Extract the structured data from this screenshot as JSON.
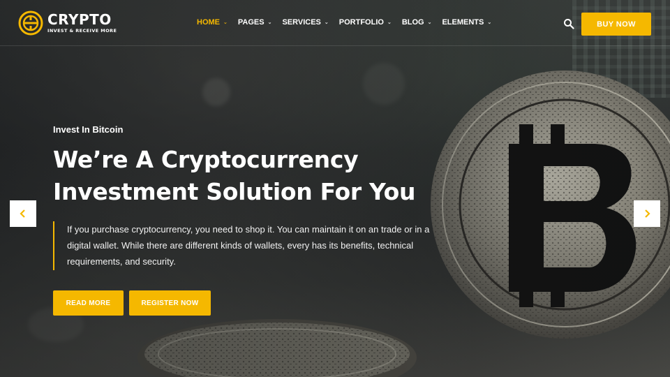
{
  "brand": {
    "name": "CRYPTO",
    "tagline": "INVEST & RECEIVE MORE",
    "accent": "#f5b800"
  },
  "nav": {
    "items": [
      {
        "label": "HOME",
        "active": true
      },
      {
        "label": "PAGES"
      },
      {
        "label": "SERVICES"
      },
      {
        "label": "PORTFOLIO"
      },
      {
        "label": "BLOG"
      },
      {
        "label": "ELEMENTS"
      }
    ],
    "chevron": "⌄",
    "search_icon": "search-icon",
    "buy_label": "BUY NOW"
  },
  "hero": {
    "kicker": "Invest In Bitcoin",
    "headline_line1": "We’re A Cryptocurrency",
    "headline_line2": "Investment Solution For You",
    "description": "If you purchase cryptocurrency, you need to shop it. You can maintain it on an trade or in a digital wallet. While there are different kinds of wallets, every has its benefits, technical requirements, and security.",
    "read_more_label": "READ MORE",
    "register_label": "REGISTER NOW"
  },
  "slider": {
    "prev_icon": "chevron-left-icon",
    "next_icon": "chevron-right-icon"
  }
}
